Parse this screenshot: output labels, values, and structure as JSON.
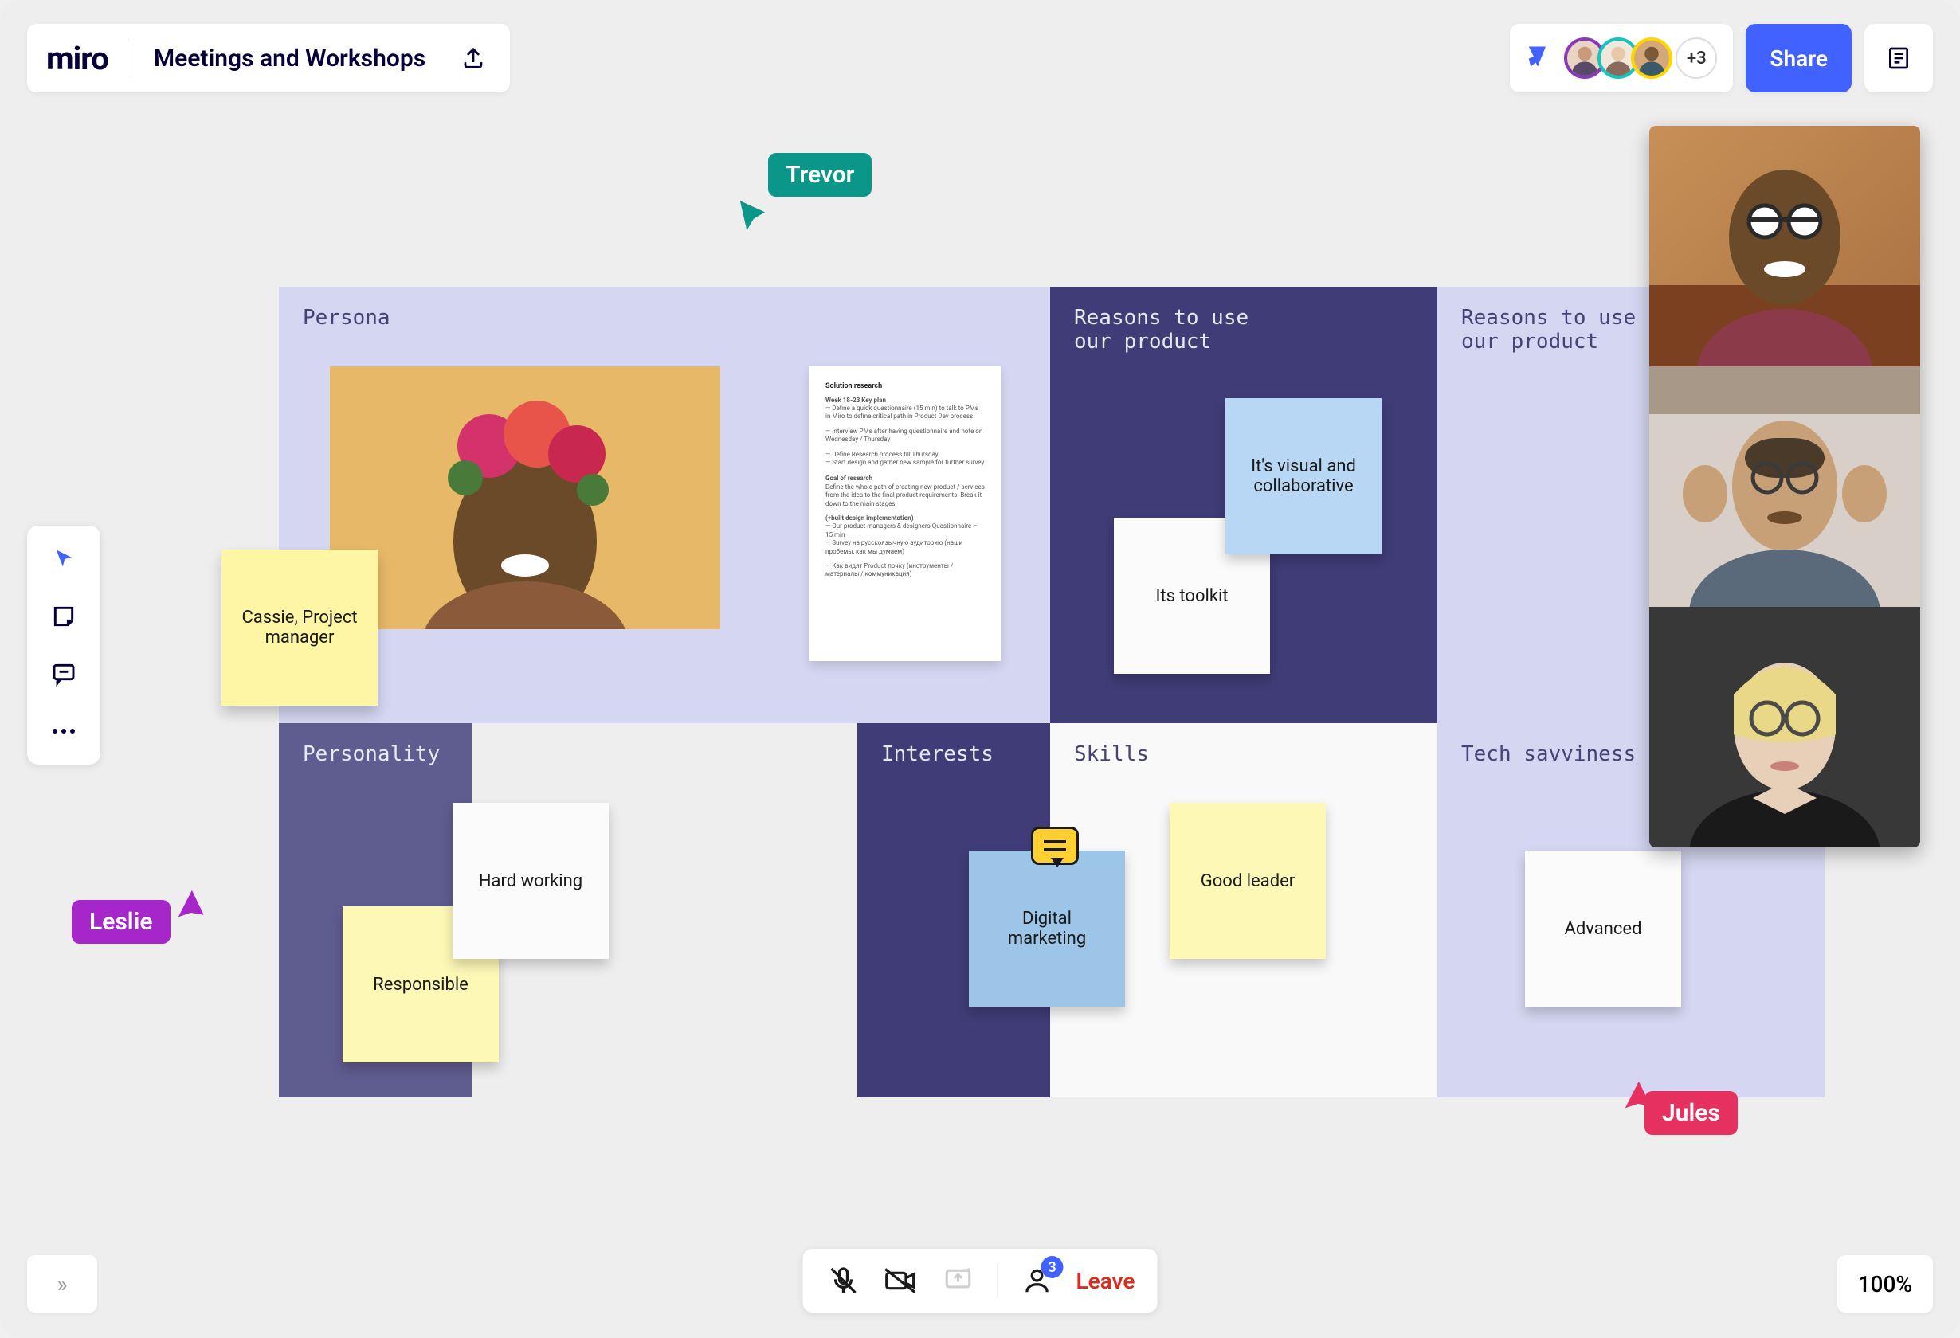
{
  "logo": "miro",
  "board_title": "Meetings and Workshops",
  "collab": {
    "avatars": [
      {
        "border": "#8a3ab9"
      },
      {
        "border": "#14c4be"
      },
      {
        "border": "#ffd700"
      }
    ],
    "more": "+3"
  },
  "share_label": "Share",
  "cursors": {
    "trevor": "Trevor",
    "leslie": "Leslie",
    "jules": "Jules"
  },
  "cells": {
    "persona": "Persona",
    "reasons1_a": "Reasons to use",
    "reasons1_b": "our product",
    "reasons2_a": "Reasons to use",
    "reasons2_b": "our product",
    "personality": "Personality",
    "interests": "Interests",
    "skills": "Skills",
    "tech": "Tech savviness"
  },
  "notes": {
    "cassie": "Cassie, Project manager",
    "visual": "It's visual and collaborative",
    "toolkit": "Its toolkit",
    "hardworking": "Hard working",
    "responsible": "Responsible",
    "marketing": "Digital marketing",
    "goodleader": "Good leader",
    "advanced": "Advanced"
  },
  "doc": {
    "title": "Solution research",
    "h1": "Week 18-23 Key plan",
    "h2": "Goal of research",
    "h3": "(+built design implementation)"
  },
  "meeting": {
    "participants_count": "3",
    "leave": "Leave"
  },
  "zoom": "100%"
}
